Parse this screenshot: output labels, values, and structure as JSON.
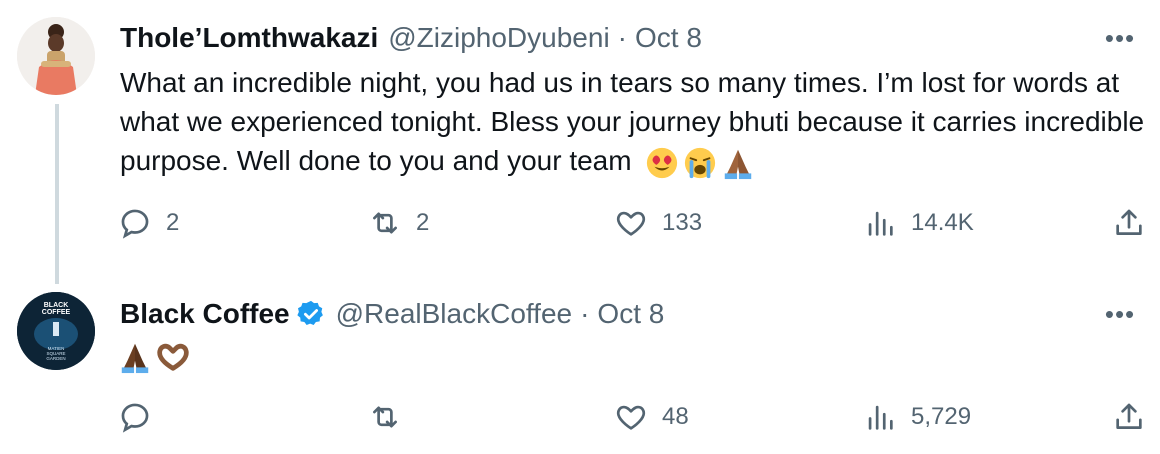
{
  "tweets": [
    {
      "name": "Thole’Lomthwakazi",
      "handle": "@ZiziphoDyubeni",
      "separator": "·",
      "date": "Oct 8",
      "text": "What an incredible night, you had us in tears so many times. I’m lost for words at what we experienced tonight. Bless your journey bhuti because it carries incredible purpose. Well done to you and your team",
      "emojis": [
        "heart-eyes-emoji",
        "crying-face-emoji",
        "folded-hands-emoji"
      ],
      "verified": false,
      "stats": {
        "replies": "2",
        "reposts": "2",
        "likes": "133",
        "views": "14.4K"
      }
    },
    {
      "name": "Black Coffee",
      "handle": "@RealBlackCoffee",
      "separator": "·",
      "date": "Oct 8",
      "text": "",
      "emojis": [
        "folded-hands-emoji",
        "heart-hands-emoji"
      ],
      "verified": true,
      "avatar_text": [
        "BLACK",
        "COFFEE",
        "MATIEN",
        "SQUARE",
        "GARDEN"
      ],
      "stats": {
        "replies": "",
        "reposts": "",
        "likes": "48",
        "views": "5,729"
      }
    }
  ],
  "colors": {
    "text": "#0f1419",
    "secondary": "#536471",
    "verified": "#1d9bf0",
    "thread_line": "#cfd9de"
  },
  "icons": [
    "reply-icon",
    "repost-icon",
    "like-icon",
    "views-icon",
    "share-icon",
    "more-icon",
    "verified-icon"
  ]
}
